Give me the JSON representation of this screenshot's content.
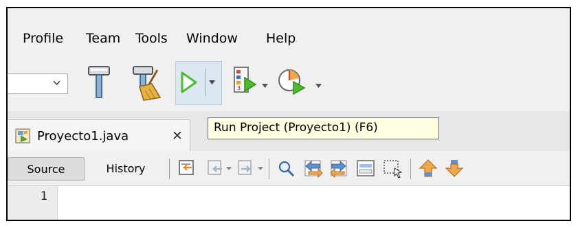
{
  "menu": [
    {
      "label": "Profile"
    },
    {
      "label": "Team"
    },
    {
      "label": "Tools"
    },
    {
      "label": "Window"
    },
    {
      "label": "Help"
    }
  ],
  "toolbar": {
    "icons": [
      "dropdown-arrow-icon",
      "hammer-build-icon",
      "clean-build-icon",
      "run-project-icon",
      "debug-project-icon",
      "profile-project-icon"
    ]
  },
  "tabs": {
    "file_tab_label": "Proyecto1.java",
    "close_glyph": "✕"
  },
  "tooltip": {
    "text": "Run Project (Proyecto1) (F6)"
  },
  "editor_toolbar": {
    "source_label": "Source",
    "history_label": "History"
  },
  "editor": {
    "line_numbers": [
      "1"
    ]
  },
  "colors": {
    "run_green": "#4cbb2c",
    "tooltip_bg": "#ffffe1",
    "hover_bg": "#dde7f2"
  }
}
